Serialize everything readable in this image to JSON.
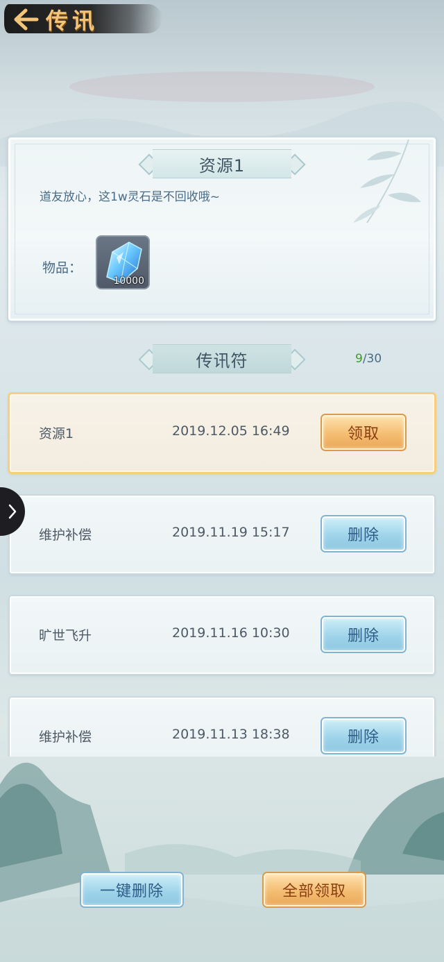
{
  "header": {
    "title": "传讯"
  },
  "detail": {
    "title": "资源1",
    "message": "道友放心，这1w灵石是不回收哦~",
    "items_label": "物品：",
    "item": {
      "name": "spirit-stone-icon",
      "count": "10000"
    }
  },
  "list": {
    "title": "传讯符",
    "counter_current": "9",
    "counter_total": "/30",
    "messages": [
      {
        "title": "资源1",
        "time": "2019.12.05 16:49",
        "action": "领取",
        "selected": true
      },
      {
        "title": "维护补偿",
        "time": "2019.11.19 15:17",
        "action": "删除",
        "selected": false
      },
      {
        "title": "旷世飞升",
        "time": "2019.11.16 10:30",
        "action": "删除",
        "selected": false
      },
      {
        "title": "维护补偿",
        "time": "2019.11.13 18:38",
        "action": "删除",
        "selected": false
      }
    ]
  },
  "footer": {
    "delete_all": "一键删除",
    "claim_all": "全部领取"
  },
  "colors": {
    "accent_gold": "#f4bd72",
    "accent_blue": "#9fd4ea",
    "counter_green": "#3f9a2c"
  }
}
